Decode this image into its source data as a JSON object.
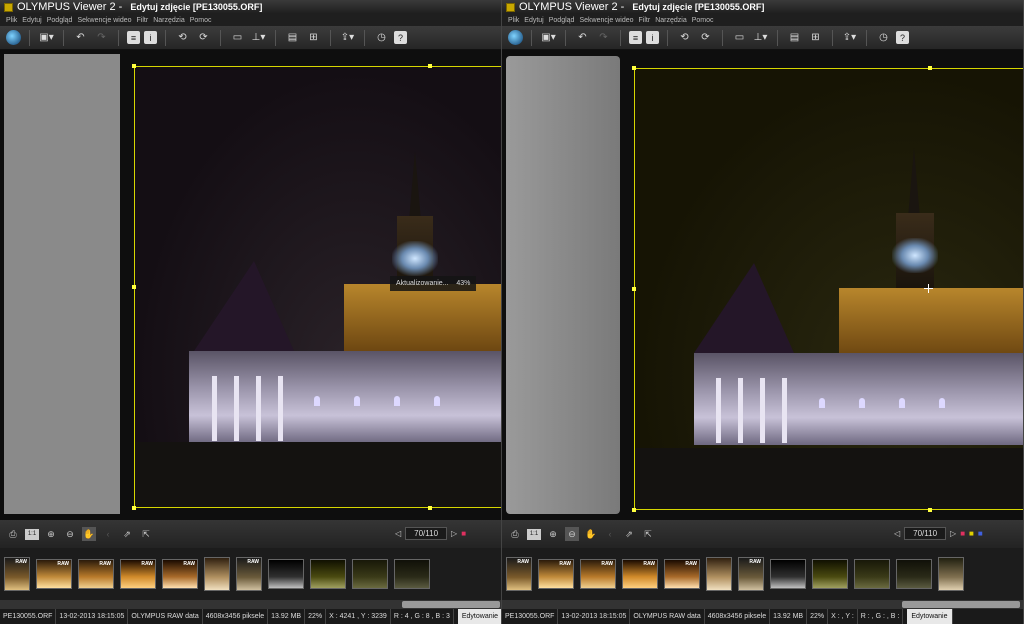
{
  "left_window": {
    "title_app": "OLYMPUS Viewer 2 -",
    "title_doc": "Edytuj zdjęcie [PE130055.ORF]",
    "menu": [
      "Plik",
      "Edytuj",
      "Podgląd",
      "Sekwencje wideo",
      "Filtr",
      "Narzędzia",
      "Pomoc"
    ],
    "progress_label": "Aktualizowanie...",
    "progress_value": "43%",
    "page_count": "70/110",
    "status": {
      "filename": "PE130055.ORF",
      "datetime": "13-02-2013 18:15:05",
      "filetype": "OLYMPUS RAW data",
      "dimensions": "4608x3456 piksele",
      "size": "13.92 MB",
      "zoom": "22%",
      "coords": "X : 4241 , Y : 3239",
      "rgb": "R : 4 , G : 8 , B : 3",
      "mode": "Edytowanie"
    }
  },
  "right_window": {
    "title_app": "OLYMPUS Viewer 2 -",
    "title_doc": "Edytuj zdjęcie [PE130055.ORF]",
    "menu": [
      "Plik",
      "Edytuj",
      "Podgląd",
      "Sekwencje wideo",
      "Filtr",
      "Narzędzia",
      "Pomoc"
    ],
    "page_count": "70/110",
    "status": {
      "filename": "PE130055.ORF",
      "datetime": "13-02-2013 18:15:05",
      "filetype": "OLYMPUS RAW data",
      "dimensions": "4608x3456 piksele",
      "size": "13.92 MB",
      "zoom": "22%",
      "coords": "X : , Y :",
      "rgb": "R : , G : , B :",
      "mode": "Edytowanie"
    }
  },
  "thumb_badge": "RAW",
  "icons": {
    "globe": "globe-icon",
    "save": "save-icon",
    "undo": "undo-icon",
    "redo": "redo-icon",
    "info": "info-icon",
    "help": "help-icon",
    "print": "print-icon",
    "zoom": "zoom-icon",
    "hand": "hand-icon"
  },
  "colors": {
    "crop_frame": "#d6d600",
    "window_bg": "#2a2a2a",
    "sky_left": "#1a141c",
    "sky_right": "#1c1a08"
  }
}
